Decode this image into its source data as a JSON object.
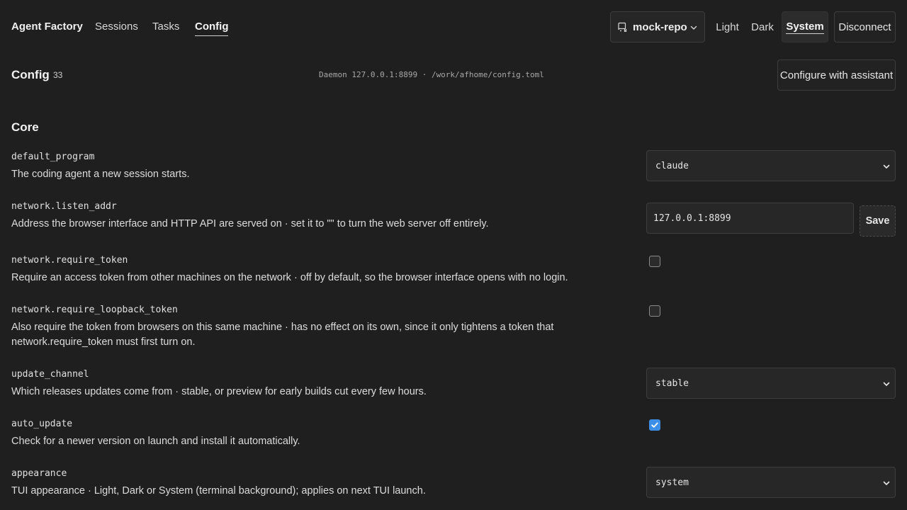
{
  "nav": {
    "brand": "Agent Factory",
    "sessions": "Sessions",
    "tasks": "Tasks",
    "config": "Config",
    "active": "Config"
  },
  "repo": {
    "name": "mock-repo"
  },
  "theme": {
    "light": "Light",
    "dark": "Dark",
    "system": "System",
    "selected": "System"
  },
  "actions": {
    "disconnect": "Disconnect",
    "configure_assistant": "Configure with assistant",
    "save": "Save"
  },
  "header": {
    "title": "Config",
    "count": "33",
    "daemon": "Daemon 127.0.0.1:8899 · /work/afhome/config.toml"
  },
  "section": {
    "title": "Core"
  },
  "settings": {
    "default_program": {
      "key": "default_program",
      "desc": "The coding agent a new session starts.",
      "value": "claude"
    },
    "listen_addr": {
      "key": "network.listen_addr",
      "desc": "Address the browser interface and HTTP API are served on · set it to \"\" to turn the web server off entirely.",
      "value": "127.0.0.1:8899"
    },
    "require_token": {
      "key": "network.require_token",
      "desc": "Require an access token from other machines on the network · off by default, so the browser interface opens with no login.",
      "checked": false
    },
    "require_loopback_token": {
      "key": "network.require_loopback_token",
      "desc": "Also require the token from browsers on this same machine · has no effect on its own, since it only tightens a token that network.require_token must first turn on.",
      "checked": false
    },
    "update_channel": {
      "key": "update_channel",
      "desc": "Which releases updates come from · stable, or preview for early builds cut every few hours.",
      "value": "stable"
    },
    "auto_update": {
      "key": "auto_update",
      "desc": "Check for a newer version on launch and install it automatically.",
      "checked": true
    },
    "appearance": {
      "key": "appearance",
      "desc": "TUI appearance · Light, Dark or System (terminal background); applies on next TUI launch.",
      "value": "system"
    }
  },
  "colors": {
    "background": "#1f1f1f",
    "accent": "#3d8ee6",
    "border": "#3d3d3d"
  },
  "icons": {
    "repo": "repo-icon",
    "chevron": "chevron-down-icon",
    "check": "check-icon"
  }
}
